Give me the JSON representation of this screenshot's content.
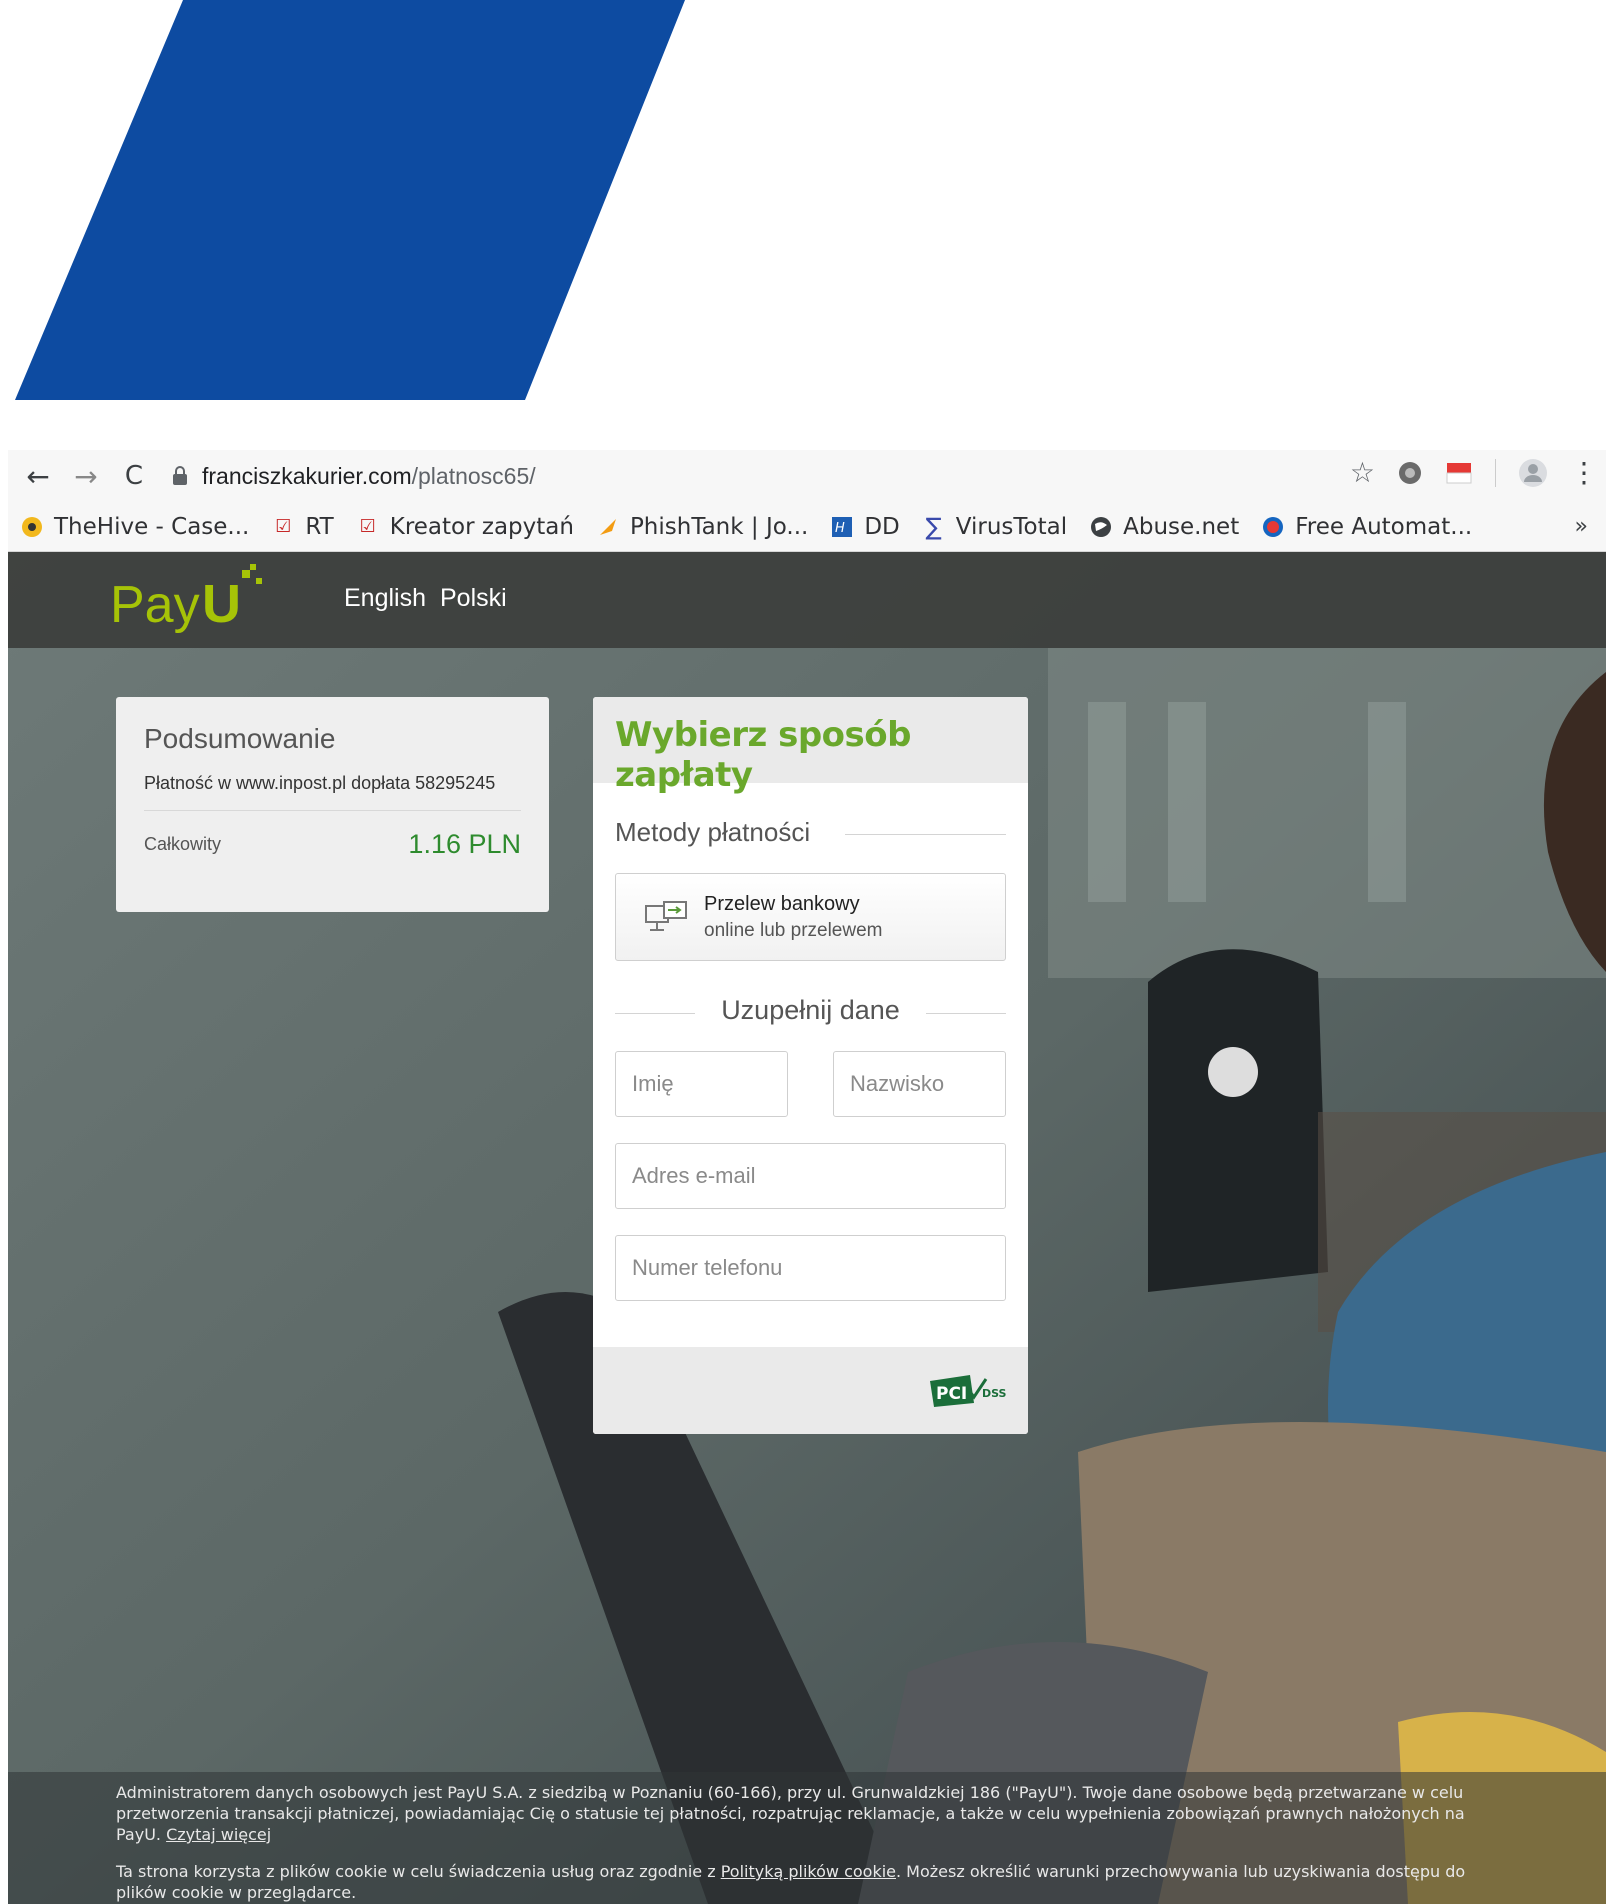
{
  "browser": {
    "url_host": "franciszkakurier.com",
    "url_path": "/platnosc65/",
    "bookmarks": [
      {
        "label": "TheHive - Case..."
      },
      {
        "label": "RT"
      },
      {
        "label": "Kreator zapytań"
      },
      {
        "label": "PhishTank | Jo..."
      },
      {
        "label": "DD"
      },
      {
        "label": "VirusTotal"
      },
      {
        "label": "Abuse.net"
      },
      {
        "label": "Free Automat..."
      }
    ],
    "more": "»"
  },
  "header": {
    "languages": [
      "English",
      "Polski"
    ]
  },
  "summary": {
    "title": "Podsumowanie",
    "description": "Płatność w www.inpost.pl dopłata 58295245",
    "total_label": "Całkowity",
    "total_value": "1.16 PLN"
  },
  "payment": {
    "title": "Wybierz sposób zapłaty",
    "methods_heading": "Metody płatności",
    "bank_transfer": {
      "title": "Przelew bankowy",
      "subtitle": "online lub przelewem"
    },
    "fill_heading": "Uzupełnij dane",
    "fields": {
      "first_name": "Imię",
      "last_name": "Nazwisko",
      "email": "Adres e-mail",
      "phone": "Numer telefonu"
    }
  },
  "legal": {
    "p1": "Administratorem danych osobowych jest PayU S.A. z siedzibą w Poznaniu (60-166), przy ul. Grunwaldzkiej 186 (\"PayU\"). Twoje dane osobowe będą przetwarzane w celu przetworzenia transakcji płatniczej, powiadamiając Cię o statusie tej płatności, rozpatrując reklamacje, a także w celu wypełnienia zobowiązań prawnych nałożonych na PayU.",
    "p1_link": "Czytaj więcej",
    "p2_before": "Ta strona korzysta z plików cookie w celu świadczenia usług oraz zgodnie z",
    "p2_link": "Polityką plików cookie",
    "p2_after": ". Możesz określić warunki przechowywania lub uzyskiwania dostępu do plików cookie w przeglądarce."
  },
  "colors": {
    "deco_blue": "#0d4ba1",
    "payu_green": "#a6c307",
    "title_green": "#6aa82c",
    "total_green": "#2e8b2e"
  }
}
